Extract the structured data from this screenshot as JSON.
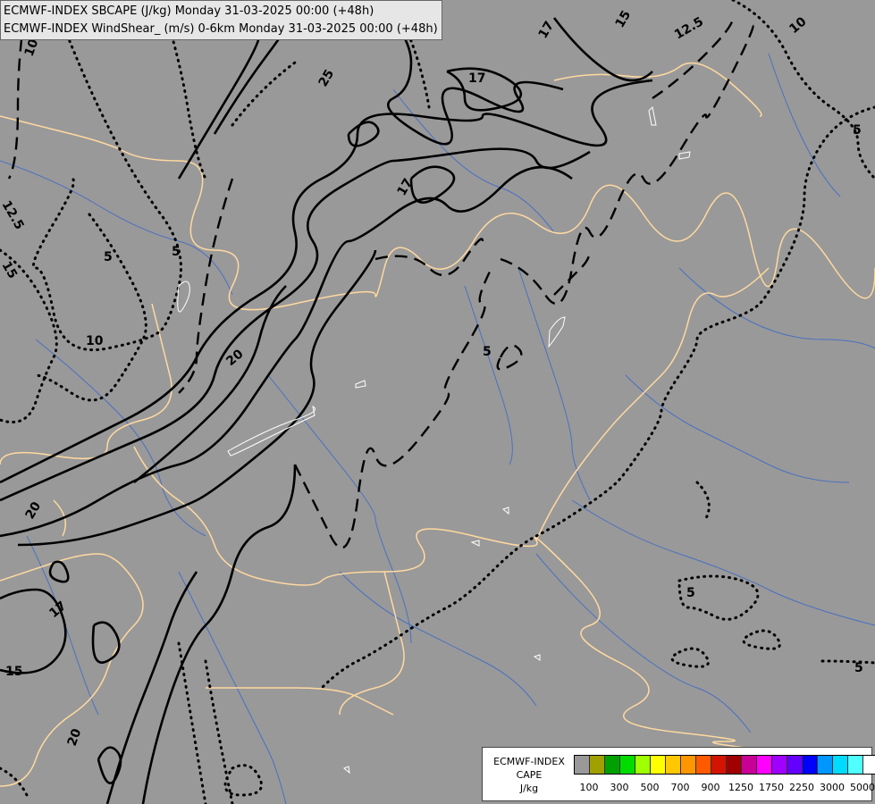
{
  "header": {
    "line1": "ECMWF-INDEX SBCAPE (J/kg) Monday 31-03-2025 00:00 (+48h)",
    "line2": "ECMWF-INDEX WindShear_ (m/s) 0-6km Monday 31-03-2025 00:00 (+48h)"
  },
  "legend": {
    "model": "ECMWF-INDEX",
    "field": "CAPE",
    "unit": "J/kg",
    "colors": [
      "#999999",
      "#a0a000",
      "#00a000",
      "#00dc00",
      "#a0ff00",
      "#ffff00",
      "#ffc800",
      "#ff9600",
      "#ff5a00",
      "#d21400",
      "#a00000",
      "#c80096",
      "#ff00ff",
      "#a000ff",
      "#6400ff",
      "#0000ff",
      "#0096ff",
      "#00dcff",
      "#50ffff",
      "#ffffff"
    ],
    "ticks": [
      "100",
      "300",
      "500",
      "700",
      "900",
      "1250",
      "1750",
      "2250",
      "3000",
      "5000"
    ]
  },
  "map": {
    "background_color": "#999999",
    "border_color": "#ffd9a0",
    "river_color": "#4a70c0",
    "contour_labels": [
      "10",
      "12.5",
      "15",
      "5",
      "5",
      "10",
      "20",
      "20",
      "17",
      "15",
      "20",
      "25",
      "17",
      "17",
      "17",
      "15",
      "12.5",
      "10",
      "5",
      "5",
      "5",
      "5"
    ]
  }
}
